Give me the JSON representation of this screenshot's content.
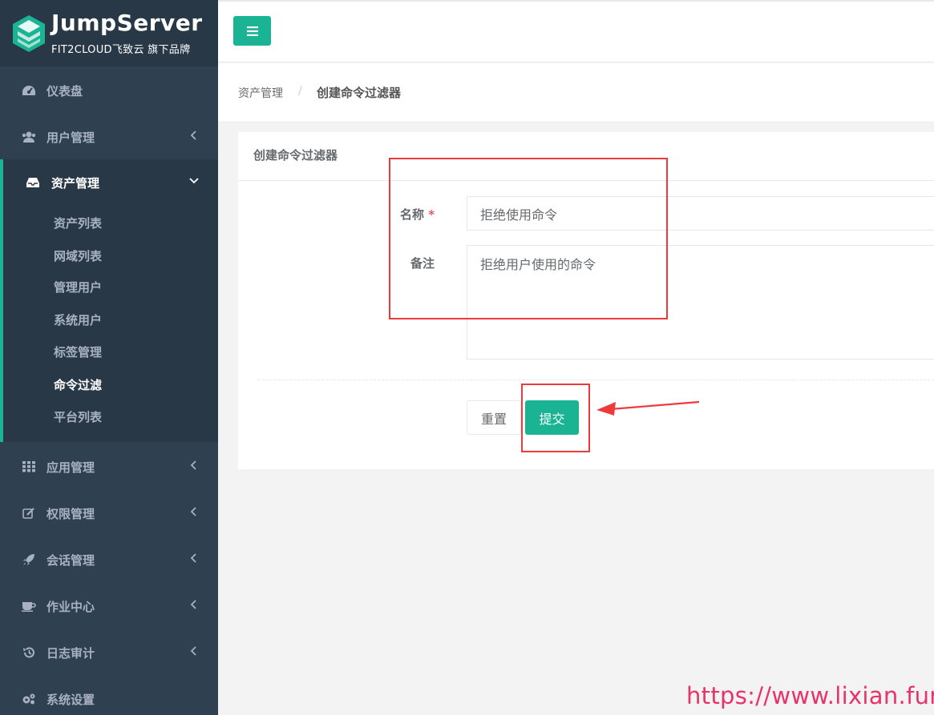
{
  "brand": {
    "title": "JumpServer",
    "subtitle": "FIT2CLOUD飞致云 旗下品牌"
  },
  "sidebar": {
    "items": [
      {
        "label": "仪表盘",
        "icon": "dashboard-icon"
      },
      {
        "label": "用户管理",
        "icon": "users-icon"
      },
      {
        "label": "资产管理",
        "icon": "inbox-icon"
      },
      {
        "label": "应用管理",
        "icon": "grid-icon"
      },
      {
        "label": "权限管理",
        "icon": "edit-icon"
      },
      {
        "label": "会话管理",
        "icon": "rocket-icon"
      },
      {
        "label": "作业中心",
        "icon": "coffee-icon"
      },
      {
        "label": "日志审计",
        "icon": "history-icon"
      },
      {
        "label": "系统设置",
        "icon": "gears-icon"
      }
    ],
    "asset_submenu": [
      "资产列表",
      "网域列表",
      "管理用户",
      "系统用户",
      "标签管理",
      "命令过滤",
      "平台列表"
    ]
  },
  "breadcrumb": {
    "parent": "资产管理",
    "separator": "/",
    "current": "创建命令过滤器"
  },
  "form": {
    "panel_title": "创建命令过滤器",
    "name_label": "名称",
    "required_mark": "*",
    "name_value": "拒绝使用命令",
    "comment_label": "备注",
    "comment_value": "拒绝用户使用的命令",
    "reset_label": "重置",
    "submit_label": "提交"
  },
  "watermark": "https://www.lixian.fun",
  "colors": {
    "accent": "#1ab394",
    "sidebar_bg": "#2f4050",
    "sidebar_active_bg": "#293846",
    "annotation_red": "#ed3b3b",
    "watermark": "#e8336a"
  }
}
